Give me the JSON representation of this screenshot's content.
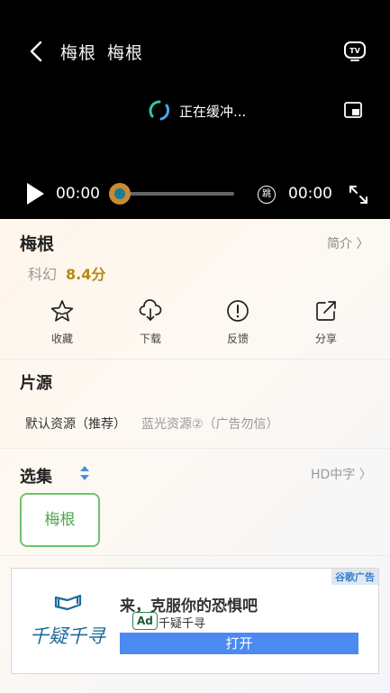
{
  "player": {
    "title_parts": [
      "梅根",
      "梅根"
    ],
    "loading_text": "正在缓冲...",
    "current_time": "00:00",
    "total_time": "00:00",
    "progress": 0,
    "skip_glyph": "跳",
    "icons": [
      "back-icon",
      "tv-icon",
      "loading-spinner-icon",
      "picture-in-picture-icon",
      "play-icon",
      "skip-icon",
      "fullscreen-icon"
    ]
  },
  "movie": {
    "title": "梅根",
    "intro_label": "简介 〉",
    "genre": "科幻",
    "score": "8.4分"
  },
  "actions": [
    {
      "label": "收藏",
      "icon": "star-icon"
    },
    {
      "label": "下载",
      "icon": "cloud-download-icon"
    },
    {
      "label": "反馈",
      "icon": "alert-icon"
    },
    {
      "label": "分享",
      "icon": "share-icon"
    }
  ],
  "sources": {
    "title": "片源",
    "items": [
      {
        "label": "默认资源（推荐）",
        "color": "#333333"
      },
      {
        "label": "蓝光资源②（广告勿信）",
        "color": "#999999"
      }
    ]
  },
  "episodes": {
    "title": "选集",
    "quality_link": "HD中字 〉",
    "items": [
      "梅根"
    ]
  },
  "ad": {
    "tag": "谷歌广告",
    "headline": "来，克服你的恐惧吧",
    "badge": "Ad",
    "advertiser": "千疑千寻",
    "cta": "打开",
    "logo_text": "千疑千寻"
  },
  "colors": {
    "accent_green": "#4aa84a",
    "score_gold": "#b38a16",
    "progress_orange": "#c98a33",
    "ad_button_blue": "#4b8af0"
  }
}
